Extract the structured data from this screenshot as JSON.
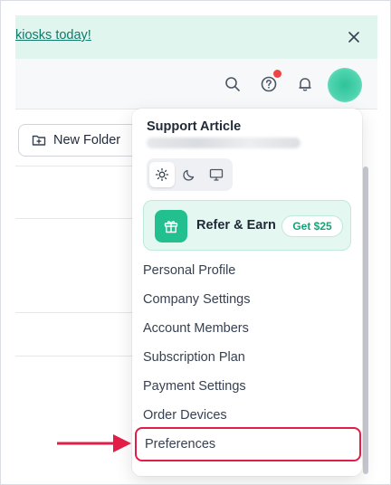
{
  "banner": {
    "text": "kiosks today!",
    "close_icon": "close-icon"
  },
  "topbar": {
    "icons": [
      "search-icon",
      "help-circle-icon",
      "bell-icon"
    ],
    "notification_color": "#ef4444"
  },
  "toolbar": {
    "new_folder_label": "New Folder"
  },
  "menu": {
    "title": "Support Article",
    "theme_options": [
      "sun-icon",
      "moon-icon",
      "monitor-icon"
    ],
    "active_theme": "light",
    "refer": {
      "label": "Refer & Earn",
      "cta": "Get $25"
    },
    "items": [
      "Personal Profile",
      "Company Settings",
      "Account Members",
      "Subscription Plan",
      "Payment Settings",
      "Order Devices",
      "Preferences"
    ],
    "highlighted_item": "Preferences"
  },
  "colors": {
    "accent": "#22c08f",
    "banner_bg": "#dff5ee",
    "highlight": "#e11d48"
  }
}
